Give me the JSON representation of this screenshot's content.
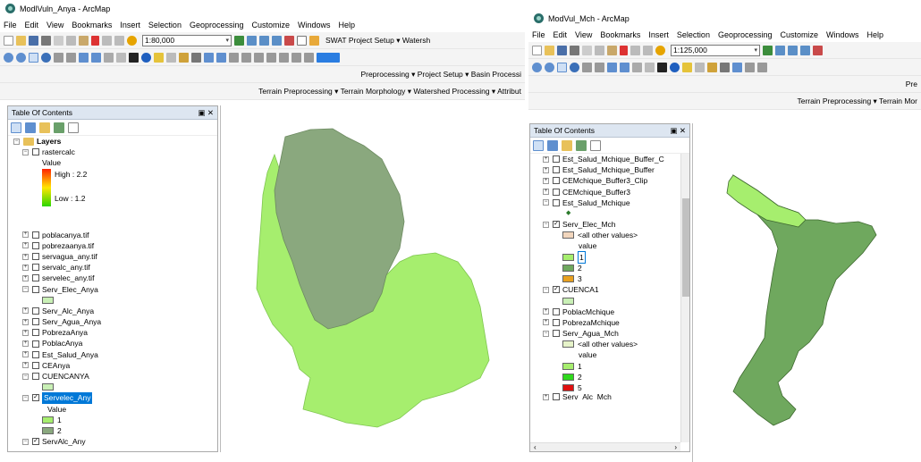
{
  "win1": {
    "title": "ModlVuln_Anya - ArcMap",
    "menu": [
      "File",
      "Edit",
      "View",
      "Bookmarks",
      "Insert",
      "Selection",
      "Geoprocessing",
      "Customize",
      "Windows",
      "Help"
    ],
    "scale": "1:80,000",
    "toolbar1_text": "SWAT Project Setup ▾ Watersh",
    "toolbar3_text": "Preprocessing ▾  Project Setup ▾  Basin Processi",
    "toolbar4_text": "Terrain Preprocessing ▾  Terrain Morphology ▾  Watershed Processing ▾  Attribut",
    "toc_title": "Table Of Contents",
    "layers_label": "Layers",
    "rastercalc": "rastercalc",
    "value_label": "Value",
    "high_label": "High : 2.2",
    "low_label": "Low : 1.2",
    "layers": [
      "poblacanya.tif",
      "pobrezaanya.tif",
      "servagua_any.tif",
      "servalc_any.tif",
      "servelec_any.tif"
    ],
    "serv_elec": "Serv_Elec_Anya",
    "layers2": [
      "Serv_Alc_Anya",
      "Serv_Agua_Anya",
      "PobrezaAnya",
      "PoblacAnya",
      "Est_Salud_Anya",
      "CEAnya"
    ],
    "cuencanya": "CUENCANYA",
    "servelec_any": "Servelec_Any",
    "sv_value": "Value",
    "sv_1": "1",
    "sv_2": "2",
    "servalc_any": "ServAlc_Any",
    "colors": {
      "light_green": "#a6ee6e",
      "dark_green": "#8aa87e"
    }
  },
  "win2": {
    "title": "ModVul_Mch - ArcMap",
    "menu": [
      "File",
      "Edit",
      "View",
      "Bookmarks",
      "Insert",
      "Selection",
      "Geoprocessing",
      "Customize",
      "Windows",
      "Help"
    ],
    "scale": "1:125,000",
    "toolbar3_text": "Pre",
    "toolbar4_text": "Terrain Preprocessing ▾  Terrain Mor",
    "toc_title": "Table Of Contents",
    "layers_top": [
      "Est_Salud_Mchique_Buffer_C",
      "Est_Salud_Mchique_Buffer",
      "CEMchique_Buffer3_Clip",
      "CEMchique_Buffer3",
      "Est_Salud_Mchique"
    ],
    "serv_elec": "Serv_Elec_Mch",
    "all_other": "<all other values>",
    "value_label": "value",
    "v1": "1",
    "v2": "2",
    "v3": "3",
    "cuenca1": "CUENCA1",
    "poblac": "PoblacMchique",
    "pobreza": "PobrezaMchique",
    "serv_agua": "Serv_Agua_Mch",
    "all_other2": "<all other values>",
    "value_label2": "value",
    "a1": "1",
    "a2": "2",
    "a5": "5",
    "serv_alc": "Serv_Alc_Mch",
    "colors": {
      "mid_green": "#6fa85e",
      "light_green": "#a6ee6e"
    }
  }
}
